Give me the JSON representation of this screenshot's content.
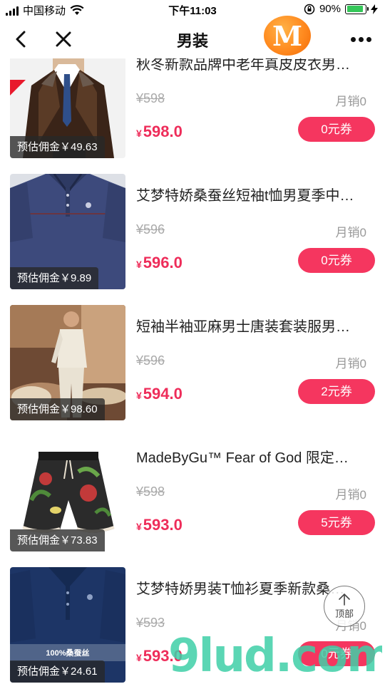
{
  "status_bar": {
    "carrier": "中国移动",
    "time": "下午11:03",
    "battery": "90%",
    "battery_level": 0.9
  },
  "nav": {
    "title": "男装",
    "brand_letter": "M"
  },
  "back_to_top": {
    "label": "顶部"
  },
  "watermark": "9lud.com",
  "products": [
    {
      "title": "秋冬新款品牌中老年真皮皮衣男…",
      "original_price": "¥598",
      "sales": "月销0",
      "currency": "¥",
      "price": "598.0",
      "coupon": "0元券",
      "commission": "预估佣金￥49.63"
    },
    {
      "title": "艾梦特娇桑蚕丝短袖t恤男夏季中…",
      "original_price": "¥596",
      "sales": "月销0",
      "currency": "¥",
      "price": "596.0",
      "coupon": "0元券",
      "commission": "预估佣金￥9.89"
    },
    {
      "title": "短袖半袖亚麻男士唐装套装服男…",
      "original_price": "¥596",
      "sales": "月销0",
      "currency": "¥",
      "price": "594.0",
      "coupon": "2元券",
      "commission": "预估佣金￥98.60"
    },
    {
      "title": "MadeByGu™ Fear of God 限定…",
      "original_price": "¥598",
      "sales": "月销0",
      "currency": "¥",
      "price": "593.0",
      "coupon": "5元券",
      "commission": "预估佣金￥73.83"
    },
    {
      "title": "艾梦特娇男装T恤衫夏季新款桑…",
      "original_price": "¥593",
      "sales": "月销0",
      "currency": "¥",
      "price": "593.0",
      "coupon": "0元券",
      "commission": "预估佣金￥24.61",
      "thumb_caption": "100%桑蚕丝"
    }
  ]
}
